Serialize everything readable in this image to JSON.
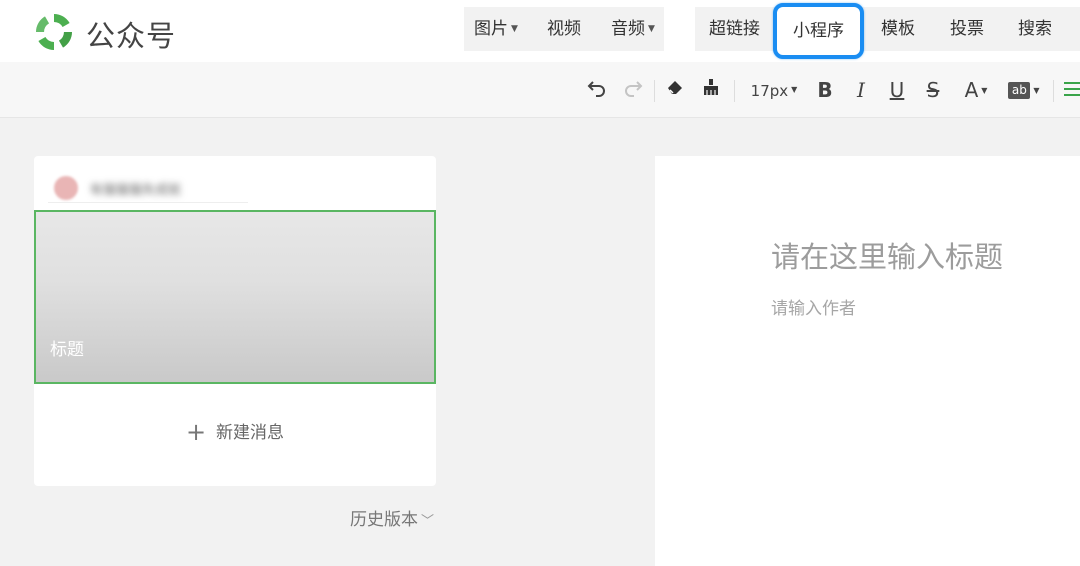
{
  "header": {
    "brand": "公众号",
    "menu_group_1": [
      {
        "label": "图片",
        "dropdown": true
      },
      {
        "label": "视频",
        "dropdown": false
      },
      {
        "label": "音频",
        "dropdown": true
      }
    ],
    "menu_group_2": [
      {
        "label": "超链接",
        "highlighted": false
      },
      {
        "label": "小程序",
        "highlighted": true
      },
      {
        "label": "模板",
        "highlighted": false
      },
      {
        "label": "投票",
        "highlighted": false
      },
      {
        "label": "搜索",
        "highlighted": false
      }
    ]
  },
  "format_toolbar": {
    "font_size": "17px",
    "bold": "B",
    "italic": "I",
    "underline": "U",
    "strike": "S",
    "font_color": "A",
    "highlight": "ab"
  },
  "article_list": {
    "account_name": "有猫猫猫失成就",
    "cover_title": "标题",
    "new_message": "新建消息",
    "history": "历史版本"
  },
  "editor": {
    "title_placeholder": "请在这里输入标题",
    "author_placeholder": "请输入作者"
  },
  "colors": {
    "brand_green": "#3aa44a",
    "highlight_blue": "#1a8df2",
    "selection_green": "#5ab662"
  }
}
